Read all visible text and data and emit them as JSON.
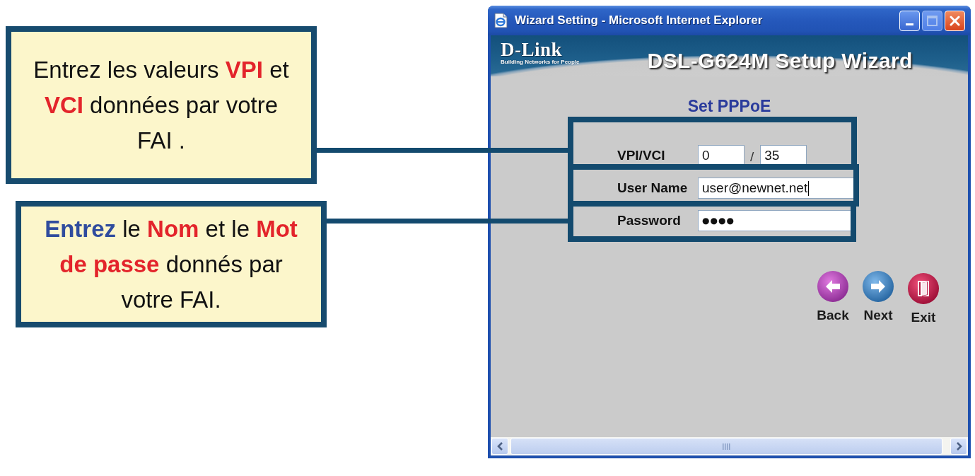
{
  "callouts": [
    {
      "segments": [
        {
          "text": "Entrez les valeurs "
        },
        {
          "text": "VPI",
          "color": "#e3242b"
        },
        {
          "text": " et "
        },
        {
          "text": "VCI",
          "color": "#e3242b"
        },
        {
          "text": " données par votre FAI ."
        }
      ]
    },
    {
      "segments": [
        {
          "text": "Entrez",
          "color": "#2f4c9e"
        },
        {
          "text": " le "
        },
        {
          "text": "Nom",
          "color": "#e3242b"
        },
        {
          "text": " et le "
        },
        {
          "text": "Mot de passe",
          "color": "#e3242b"
        },
        {
          "text": " donnés par votre FAI."
        }
      ]
    }
  ],
  "browser": {
    "window": {
      "title": "Wizard Setting - Microsoft Internet Explorer",
      "controls": [
        {
          "kind": "minimize",
          "disabled": false
        },
        {
          "kind": "maximize",
          "disabled": true
        },
        {
          "kind": "close",
          "disabled": false
        }
      ]
    },
    "banner": {
      "logo": "D-Link",
      "tagline": "Building Networks for People",
      "title": "DSL-G624M Setup Wizard"
    },
    "page": {
      "heading": "Set PPPoE",
      "fields": [
        {
          "kind": "pair",
          "label": "VPI/VCI",
          "values": [
            "0",
            "35"
          ],
          "separator": "/"
        },
        {
          "kind": "text",
          "label": "User Name",
          "value": "user@newnet.net",
          "focused": true
        },
        {
          "kind": "password",
          "label": "Password",
          "value": "●●●●",
          "focused": false
        }
      ],
      "buttons": [
        {
          "kind": "back",
          "label": "Back"
        },
        {
          "kind": "next",
          "label": "Next"
        },
        {
          "kind": "exit",
          "label": "Exit"
        }
      ]
    }
  }
}
